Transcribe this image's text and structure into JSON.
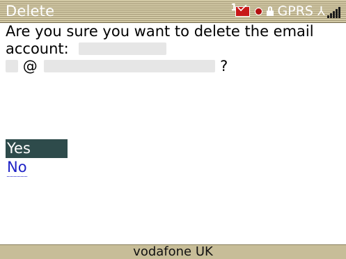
{
  "title_bar": {
    "title": "Delete",
    "status": {
      "message_count": "1",
      "network": "GPRS",
      "signal_bars": 5
    }
  },
  "dialog": {
    "prompt_line1": "Are you sure you want to delete the email",
    "prompt_line2_prefix": "account:",
    "at_symbol": "@",
    "question_mark": "?"
  },
  "options": {
    "yes": "Yes",
    "no": "No"
  },
  "bottom_bar": {
    "carrier": "vodafone UK"
  },
  "colors": {
    "title_bar": "#a49977",
    "selected_option": "#2e4b4b",
    "link": "#1f22c6",
    "bottom_bar": "#c7bd98"
  },
  "icons": [
    "message-icon",
    "red-dot-icon",
    "lock-icon",
    "signal-icon"
  ]
}
